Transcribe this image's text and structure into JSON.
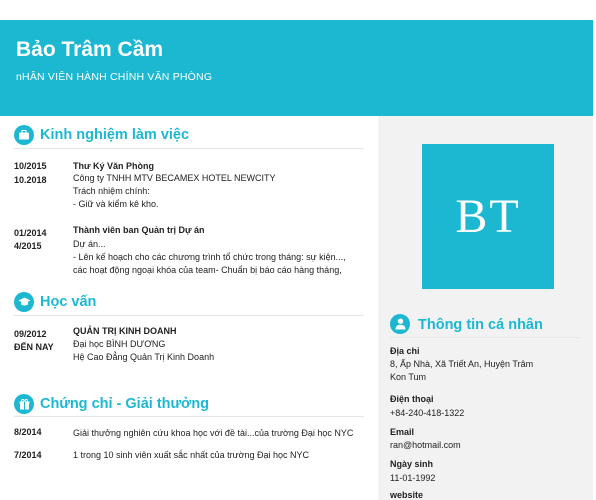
{
  "header": {
    "name": "Bảo Trâm Cầm",
    "title": "nHÂN VIÊN HÀNH CHÍNH VĂN PHÒNG"
  },
  "avatar": {
    "initials": "BT"
  },
  "experience": {
    "heading": "Kinh nghiệm làm việc",
    "icon": "briefcase-icon",
    "items": [
      {
        "start": "10/2015",
        "end": "10.2018",
        "role": "Thư Ký Văn Phòng",
        "company": "Công ty TNHH MTV BECAMEX HOTEL NEWCITY",
        "detail1": "Trách nhiệm chính:",
        "detail2": "- Giữ và kiểm kê kho."
      },
      {
        "start": "01/2014",
        "end": "4/2015",
        "role": "Thành viên ban Quản trị Dự án",
        "company": "Dự án...",
        "detail1": "- Lên kế hoạch cho các chương trình tổ chức trong tháng: sự kiện...,",
        "detail2": "các hoạt động ngoại khóa của team- Chuẩn bị báo cáo hàng tháng,"
      }
    ]
  },
  "education": {
    "heading": "Học vấn",
    "icon": "graduation-cap-icon",
    "start": "09/2012",
    "end": "ĐẾN NAY",
    "major": "QUẢN TRỊ KINH DOANH",
    "school": "Đại học BÌNH DƯƠNG",
    "system": "Hệ Cao Đẳng Quản Trị Kinh Doanh"
  },
  "awards": {
    "heading": "Chứng chỉ - Giải thưởng",
    "icon": "gift-icon",
    "items": [
      {
        "date": "8/2014",
        "text": "Giải thưởng nghiên cứu khoa học với đề tài...của trường Đại học NYC"
      },
      {
        "date": "7/2014",
        "text": "1 trong 10 sinh viên xuất sắc nhất của trường Đại học NYC"
      }
    ]
  },
  "personal": {
    "heading": "Thông tin cá nhân",
    "icon": "user-icon",
    "address_label": "Địa chỉ",
    "address_line1": "8, Ấp Nhà, Xã Triết An, Huyện Trâm",
    "address_line2": "Kon Tum",
    "phone_label": "Điện thoại",
    "phone": "+84-240-418-1322",
    "email_label": "Email",
    "email": "ran@hotmail.com",
    "birth_label": "Ngày sinh",
    "birth": "11-01-1992",
    "website_label": "website"
  },
  "colors": {
    "accent": "#1cb8d2",
    "sidebar": "#f2f2f2"
  }
}
